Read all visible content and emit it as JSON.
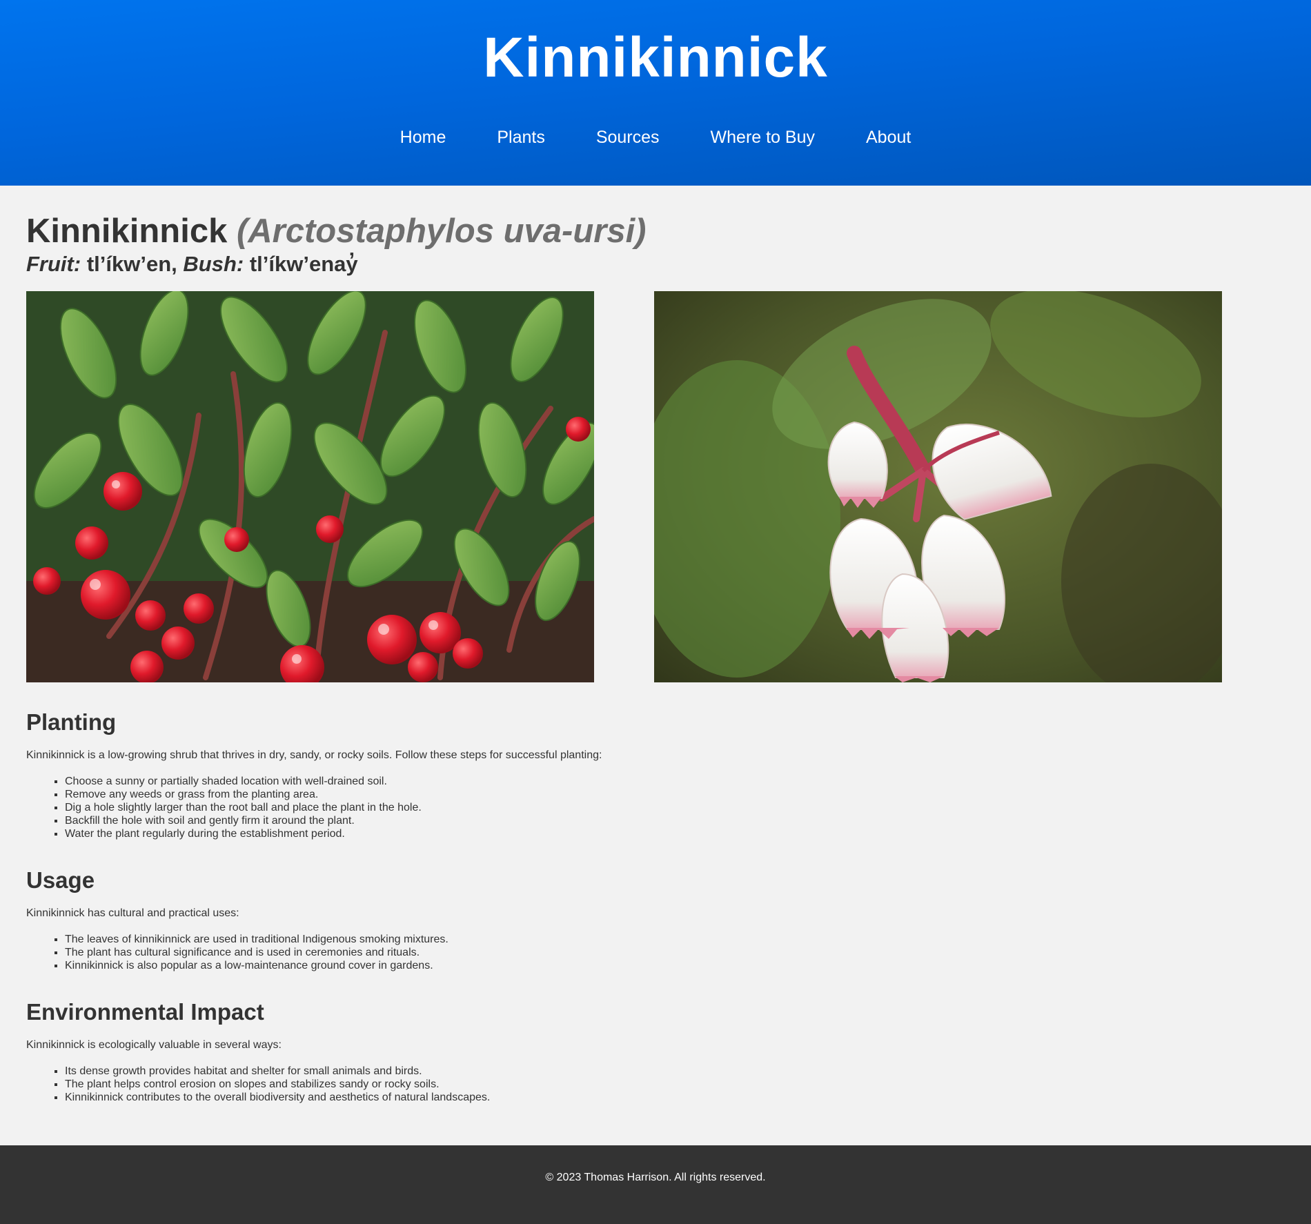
{
  "header": {
    "site_title": "Kinnikinnick",
    "nav": [
      {
        "label": "Home"
      },
      {
        "label": "Plants"
      },
      {
        "label": "Sources"
      },
      {
        "label": "Where to Buy"
      },
      {
        "label": "About"
      }
    ]
  },
  "plant": {
    "common_name": "Kinnikinnick",
    "latin_name": "(Arctostaphylos uva-ursi)",
    "fruit_label": "Fruit:",
    "fruit_name": "tl’íkw’en,",
    "bush_label": "Bush:",
    "bush_name": "tl’íkw’enay̓"
  },
  "sections": {
    "planting": {
      "title": "Planting",
      "intro": "Kinnikinnick is a low-growing shrub that thrives in dry, sandy, or rocky soils. Follow these steps for successful planting:",
      "items": [
        "Choose a sunny or partially shaded location with well-drained soil.",
        "Remove any weeds or grass from the planting area.",
        "Dig a hole slightly larger than the root ball and place the plant in the hole.",
        "Backfill the hole with soil and gently firm it around the plant.",
        "Water the plant regularly during the establishment period."
      ]
    },
    "usage": {
      "title": "Usage",
      "intro": "Kinnikinnick has cultural and practical uses:",
      "items": [
        "The leaves of kinnikinnick are used in traditional Indigenous smoking mixtures.",
        "The plant has cultural significance and is used in ceremonies and rituals.",
        "Kinnikinnick is also popular as a low-maintenance ground cover in gardens."
      ]
    },
    "environmental": {
      "title": "Environmental Impact",
      "intro": "Kinnikinnick is ecologically valuable in several ways:",
      "items": [
        "Its dense growth provides habitat and shelter for small animals and birds.",
        "The plant helps control erosion on slopes and stabilizes sandy or rocky soils.",
        "Kinnikinnick contributes to the overall biodiversity and aesthetics of natural landscapes."
      ]
    }
  },
  "footer": {
    "copyright": "© 2023 Thomas Harrison. All rights reserved."
  }
}
